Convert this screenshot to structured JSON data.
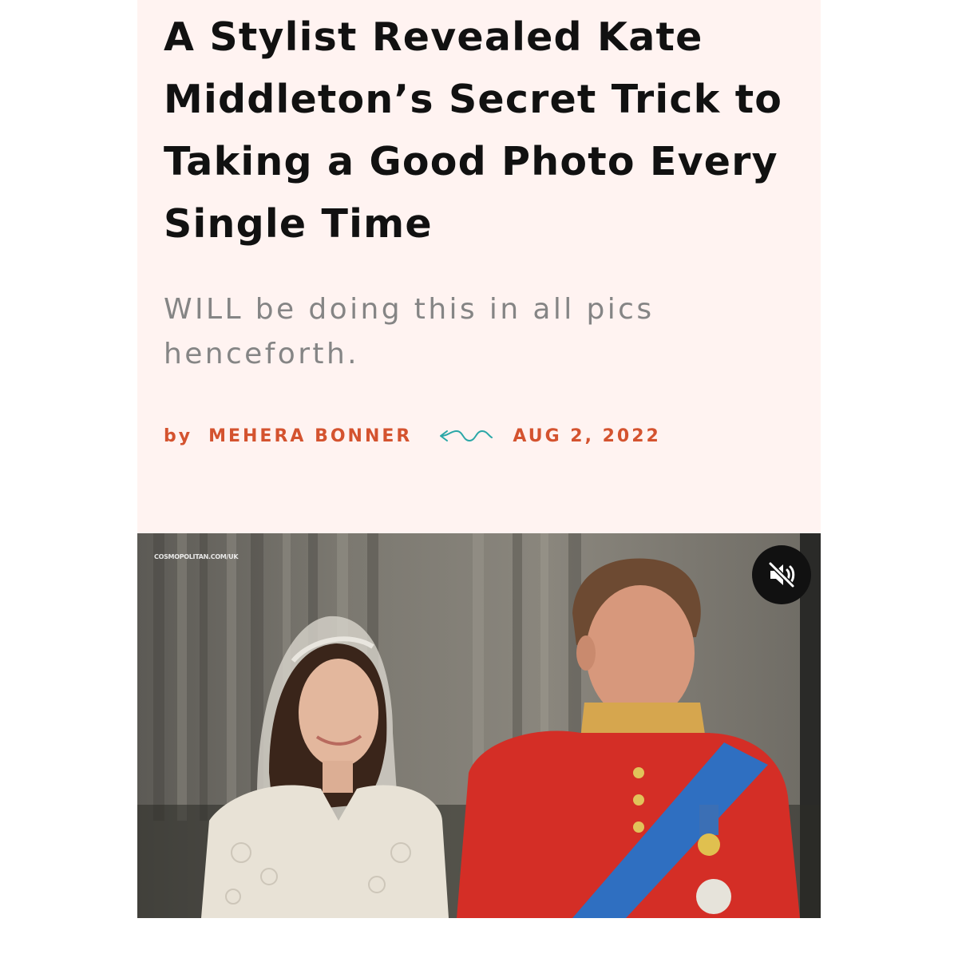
{
  "article": {
    "headline": "A Stylist Revealed Kate Middleton’s Secret Trick to Taking a Good Photo Every Single Time",
    "dek": "WILL be doing this in all pics henceforth.",
    "byline": {
      "prefix": "by",
      "author": "MEHERA BONNER",
      "date": "AUG 2, 2022",
      "divider_icon": "squiggle-icon"
    }
  },
  "video": {
    "watermark": "COSMOPOLITAN.COM/UK",
    "mute_icon": "speaker-muted-icon"
  },
  "colors": {
    "background": "#fff3f1",
    "headline": "#111111",
    "dek": "#858585",
    "byline": "#d4532f",
    "divider": "#2aa7a7"
  }
}
